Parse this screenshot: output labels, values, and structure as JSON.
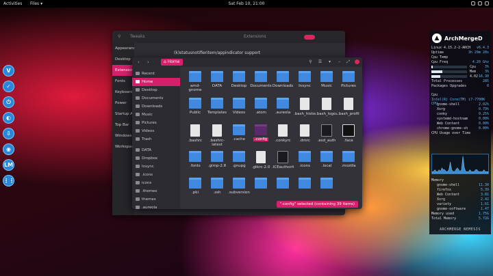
{
  "topbar": {
    "activities": "Activities",
    "app_menu": "Files ▾",
    "clock": "Sat Feb 10, 21:00"
  },
  "dock": [
    {
      "name": "dock-item-v",
      "glyph": "V"
    },
    {
      "name": "dock-item-shield",
      "glyph": "✓"
    },
    {
      "name": "dock-item-power",
      "glyph": "⏻"
    },
    {
      "name": "dock-item-app",
      "glyph": "◐"
    },
    {
      "name": "dock-item-download",
      "glyph": "⇩"
    },
    {
      "name": "dock-item-toggle",
      "glyph": "◉"
    },
    {
      "name": "dock-item-lm",
      "glyph": "LM"
    },
    {
      "name": "dock-item-grid",
      "glyph": "⋮⋮"
    }
  ],
  "tweaks": {
    "search_glyph": "⚲",
    "title": "Tweaks",
    "header_section": "Extensions",
    "sidebar": [
      "Appearance",
      "Desktop",
      "Extensions",
      "Fonts",
      "Keyboard",
      "Power",
      "Startup Ap",
      "Top Bar",
      "Windows",
      "Workspace"
    ],
    "extension_row": "(k)statusnotifieritem/appindicator support"
  },
  "files": {
    "back": "‹",
    "forward": "›",
    "location": "Home",
    "tools": [
      "⚲",
      "☰",
      "▾",
      "–",
      "⤢"
    ],
    "sidebar": [
      {
        "label": "Recent"
      },
      {
        "label": "Home",
        "active": true
      },
      {
        "label": "Desktop"
      },
      {
        "label": "Documents"
      },
      {
        "label": "Downloads"
      },
      {
        "label": "Music"
      },
      {
        "label": "Pictures"
      },
      {
        "label": "Videos"
      },
      {
        "label": "Trash"
      },
      {
        "sep": true
      },
      {
        "label": "DATA"
      },
      {
        "label": "Dropbox"
      },
      {
        "label": "Insync"
      },
      {
        "label": ".icons"
      },
      {
        "label": "icons"
      },
      {
        "label": ".themes"
      },
      {
        "label": "themes"
      },
      {
        "label": ".aureola"
      }
    ],
    "items": [
      {
        "label": "amd-gnome",
        "kind": "folder"
      },
      {
        "label": "DATA",
        "kind": "folder"
      },
      {
        "label": "Desktop",
        "kind": "folder"
      },
      {
        "label": "Documents",
        "kind": "folder"
      },
      {
        "label": "Downloads",
        "kind": "folder"
      },
      {
        "label": "Insync",
        "kind": "folder"
      },
      {
        "label": "Music",
        "kind": "folder"
      },
      {
        "label": "Pictures",
        "kind": "folder"
      },
      {
        "label": "Public",
        "kind": "folder"
      },
      {
        "label": "Templates",
        "kind": "folder"
      },
      {
        "label": "Videos",
        "kind": "folder"
      },
      {
        "label": ".atom",
        "kind": "folder"
      },
      {
        "label": ".aureola",
        "kind": "folder"
      },
      {
        "label": ".bash_history",
        "kind": "doc"
      },
      {
        "label": ".bash_logout",
        "kind": "doc"
      },
      {
        "label": ".bash_profile",
        "kind": "doc"
      },
      {
        "label": ".bashrc",
        "kind": "doc"
      },
      {
        "label": ".bashrc-latest",
        "kind": "doc"
      },
      {
        "label": ".cache",
        "kind": "folder"
      },
      {
        "label": ".config",
        "kind": "selfolder",
        "selected": true
      },
      {
        "label": ".conkyrc",
        "kind": "doc"
      },
      {
        "label": ".dmrc",
        "kind": "doc"
      },
      {
        "label": ".esd_auth",
        "kind": "dark"
      },
      {
        "label": ".face",
        "kind": "arch"
      },
      {
        "label": ".fonts",
        "kind": "folder"
      },
      {
        "label": ".gimp-2.8",
        "kind": "folder"
      },
      {
        "label": ".gnupg",
        "kind": "folder"
      },
      {
        "label": ".gtkrc-2.0",
        "kind": "doc"
      },
      {
        "label": ".ICEauthority",
        "kind": "dark"
      },
      {
        "label": ".icons",
        "kind": "folder"
      },
      {
        "label": ".local",
        "kind": "folder"
      },
      {
        "label": ".mozilla",
        "kind": "folder"
      },
      {
        "label": ".pki",
        "kind": "folder"
      },
      {
        "label": ".ssh",
        "kind": "folder"
      },
      {
        "label": ".subversion",
        "kind": "folder"
      },
      {
        "label": "",
        "kind": "folder"
      },
      {
        "label": "",
        "kind": "folder"
      },
      {
        "label": "",
        "kind": "folder"
      },
      {
        "label": "",
        "kind": "folder"
      }
    ],
    "status": "\".config\" selected (containing 39 items)"
  },
  "conky": {
    "host": "ArchMergeD",
    "kernel": {
      "k": "Linux 4.15.2-2-ARCH",
      "v": "v6.4.3"
    },
    "rows": [
      {
        "k": "Uptime",
        "v": "3h 29m 20s"
      },
      {
        "k": "Cpu Temp",
        "v": ""
      },
      {
        "k": "Cpu Freq",
        "v": "4.20 Ghz"
      },
      {
        "k": "",
        "v": "3%",
        "bar": 0.03,
        "label": "Cpu"
      },
      {
        "k": "",
        "v": "3%",
        "bar": 0.3,
        "label": "Mem"
      },
      {
        "k": "",
        "v": "16.30",
        "bar": 0.25,
        "label": "4.02"
      },
      {
        "k": "Total Processes",
        "v": "285"
      },
      {
        "k": "Packages Upgrades",
        "v": "0"
      }
    ],
    "cpu_header": "Cpu",
    "cpu_model": "Intel(R) Core(TM) i7-7700K CPU",
    "procs": [
      {
        "k": "gnome-shell",
        "v": "2.02%"
      },
      {
        "k": "Xorg",
        "v": "0.79%"
      },
      {
        "k": "conky",
        "v": "0.25%"
      },
      {
        "k": "systemd-hostnam",
        "v": "0.00%"
      },
      {
        "k": "Web Content",
        "v": "0.00%"
      },
      {
        "k": "chrome-gnome-sh",
        "v": "0.00%"
      }
    ],
    "cpu_graph_label": "CPU Usage over Time",
    "cpu_graph": [
      1,
      1,
      2,
      1,
      1,
      2,
      1,
      3,
      2,
      2,
      1,
      1,
      2,
      6,
      2,
      1,
      1,
      2,
      3,
      2,
      1,
      2,
      9,
      3,
      1,
      1,
      1,
      2,
      1,
      1,
      1,
      2,
      2,
      1,
      1,
      1,
      1,
      2,
      1,
      1,
      1
    ],
    "memory_header": "Memory",
    "mem": [
      {
        "k": "gnome-shell",
        "v": "11.30"
      },
      {
        "k": "firefox",
        "v": "5.39"
      },
      {
        "k": "Web Content",
        "v": "3.81"
      },
      {
        "k": "Xorg",
        "v": "2.42"
      },
      {
        "k": "variety",
        "v": "1.61"
      },
      {
        "k": "gnome-software",
        "v": "1.47"
      }
    ],
    "memory_used": {
      "k": "Memory used",
      "v": "1.75G"
    },
    "total_memory": {
      "k": "Total Memory",
      "v": "5.72G"
    },
    "footer": "ARCHMERGE NEMESIS"
  }
}
